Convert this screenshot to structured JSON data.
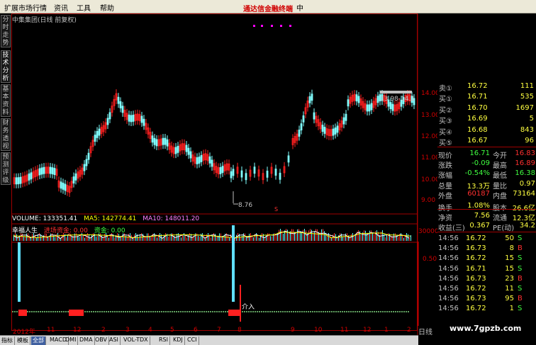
{
  "menu": {
    "items": [
      "扩展市场行情",
      "资讯",
      "工具",
      "帮助"
    ],
    "broker": "通达信金融终端",
    "trailing": "中"
  },
  "side_tabs": [
    "分时走势",
    "技术分析",
    "基本资料",
    "财务透视",
    "预测评级"
  ],
  "chart": {
    "title": "中集集团(日线 前复权)",
    "low_marker": "8.76",
    "range_box": "13.98-14.1",
    "marker_s": "S",
    "intervene": "介入",
    "day_label": "日线"
  },
  "price_axis": [
    "14.00",
    "13.00",
    "12.00",
    "11.00",
    "10.00",
    "9.00"
  ],
  "volume": {
    "label": "VOLUME: 133351.41",
    "ma5": "MA5: 142774.41",
    "ma10": "MA10: 148011.20",
    "axis": "30000"
  },
  "indicator": {
    "name": "幸福人生",
    "f1": "进场资金: 0.00",
    "f2": "资金: 0.00",
    "axis": "0.50"
  },
  "x_labels": [
    "2012年",
    "11",
    "12",
    "2",
    "3",
    "4",
    "5",
    "6",
    "7",
    "8",
    "9",
    "10",
    "11",
    "12",
    "1",
    "2"
  ],
  "bottom_tabs": [
    "指标",
    "模板",
    "全部",
    "MACD",
    "DMI",
    "DMA",
    "OBV",
    "ASI",
    "VOL-TDX",
    "RSI",
    "KDJ",
    "CCI"
  ],
  "quote": {
    "asks": [
      {
        "l": "卖①",
        "p": "16.72",
        "v": "111"
      }
    ],
    "bids": [
      {
        "l": "买①",
        "p": "16.71",
        "v": "535"
      },
      {
        "l": "买②",
        "p": "16.70",
        "v": "1697"
      },
      {
        "l": "买③",
        "p": "16.69",
        "v": "5"
      },
      {
        "l": "买④",
        "p": "16.68",
        "v": "843"
      },
      {
        "l": "买⑤",
        "p": "16.67",
        "v": "96"
      }
    ],
    "stats": [
      {
        "a": "现价",
        "av": "16.71",
        "b": "今开",
        "bv": "16.83"
      },
      {
        "a": "涨跌",
        "av": "-0.09",
        "b": "最高",
        "bv": "16.89"
      },
      {
        "a": "涨幅",
        "av": "-0.54%",
        "b": "最低",
        "bv": "16.38"
      },
      {
        "a": "总量",
        "av": "13.3万",
        "b": "量比",
        "bv": "0.97"
      },
      {
        "a": "外盘",
        "av": "60187",
        "b": "内盘",
        "bv": "73164"
      },
      {
        "a": "换手",
        "av": "1.08%",
        "b": "股本",
        "bv": "26.6亿"
      },
      {
        "a": "净资",
        "av": "7.56",
        "b": "流通",
        "bv": "12.3亿"
      },
      {
        "a": "收益(三)",
        "av": "0.367",
        "b": "PE(动)",
        "bv": "34.2"
      }
    ],
    "ticks": [
      {
        "t": "14:56",
        "p": "16.72",
        "v": "50",
        "d": "S"
      },
      {
        "t": "14:56",
        "p": "16.73",
        "v": "8",
        "d": "B"
      },
      {
        "t": "14:56",
        "p": "16.72",
        "v": "15",
        "d": "S"
      },
      {
        "t": "14:56",
        "p": "16.71",
        "v": "15",
        "d": "S"
      },
      {
        "t": "14:56",
        "p": "16.73",
        "v": "23",
        "d": "B"
      },
      {
        "t": "14:56",
        "p": "16.72",
        "v": "11",
        "d": "S"
      },
      {
        "t": "14:56",
        "p": "16.73",
        "v": "95",
        "d": "B"
      },
      {
        "t": "14:56",
        "p": "16.72",
        "v": "1",
        "d": "S"
      }
    ]
  },
  "watermark": "www.7gpzb.com"
}
